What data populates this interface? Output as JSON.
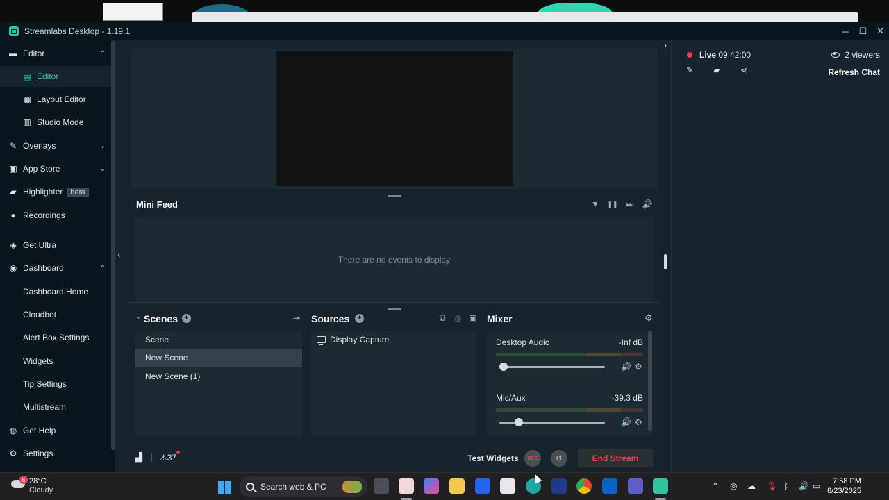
{
  "window": {
    "title": "Streamlabs Desktop - 1.19.1",
    "controls": {
      "minimize": "─",
      "maximize": "☐",
      "close": "✕"
    }
  },
  "sidebar": {
    "items": [
      {
        "label": "Editor",
        "icon": "folder-icon",
        "glyph": "▬",
        "chevron": "⌃"
      },
      {
        "label": "Editor",
        "icon": "editor-icon",
        "glyph": "▤",
        "active": true
      },
      {
        "label": "Layout Editor",
        "icon": "layout-grid-icon",
        "glyph": "▦"
      },
      {
        "label": "Studio Mode",
        "icon": "studio-mode-icon",
        "glyph": "▥"
      },
      {
        "label": "Overlays",
        "icon": "overlays-icon",
        "glyph": "✎",
        "chevron": "⌄"
      },
      {
        "label": "App Store",
        "icon": "store-icon",
        "glyph": "▣",
        "chevron": "⌄"
      },
      {
        "label": "Highlighter",
        "icon": "highlighter-icon",
        "glyph": "▰",
        "badge": "beta"
      },
      {
        "label": "Recordings",
        "icon": "recordings-icon",
        "glyph": "●"
      },
      {
        "label": "Get Ultra",
        "icon": "ultra-icon",
        "glyph": "◈"
      },
      {
        "label": "Dashboard",
        "icon": "dashboard-icon",
        "glyph": "◉",
        "chevron": "⌃"
      },
      {
        "label": "Dashboard Home"
      },
      {
        "label": "Cloudbot"
      },
      {
        "label": "Alert Box Settings"
      },
      {
        "label": "Widgets"
      },
      {
        "label": "Tip Settings"
      },
      {
        "label": "Multistream"
      },
      {
        "label": "Get Help",
        "icon": "help-icon",
        "glyph": "◍"
      },
      {
        "label": "Settings",
        "icon": "gear-icon",
        "glyph": "⚙"
      }
    ]
  },
  "minifeed": {
    "title": "Mini Feed",
    "empty_text": "There are no events to display",
    "controls": {
      "filter": "▼",
      "pause": "❚❚",
      "skip": "⏭",
      "volume": "🔊"
    }
  },
  "scenes": {
    "title": "Scenes",
    "items": [
      "Scene",
      "New Scene",
      "New Scene (1)"
    ],
    "selected": "New Scene"
  },
  "sources": {
    "title": "Sources",
    "items": [
      "Display Capture"
    ]
  },
  "mixer": {
    "title": "Mixer",
    "channels": [
      {
        "name": "Desktop Audio",
        "level": "-Inf dB",
        "volume": 0.0
      },
      {
        "name": "Mic/Aux",
        "level": "-39.3 dB",
        "volume": 0.16
      }
    ]
  },
  "footer": {
    "alert_count": "37",
    "test_widgets": "Test Widgets",
    "rec_label": "REC",
    "end_stream": "End Stream"
  },
  "chat": {
    "live_label": "Live",
    "live_time": "09:42:00",
    "viewers": "2 viewers",
    "refresh": "Refresh Chat"
  },
  "taskbar": {
    "weather_temp": "28°C",
    "weather_desc": "Cloudy",
    "weather_badge": "6",
    "search_placeholder": "Search web & PC",
    "time": "7:58 PM",
    "date": "8/23/2025"
  },
  "colors": {
    "accent": "#31c3a2",
    "live_red": "#e2434f",
    "panel_bg": "#1c2a32",
    "sidebar_bg": "#09161d"
  }
}
